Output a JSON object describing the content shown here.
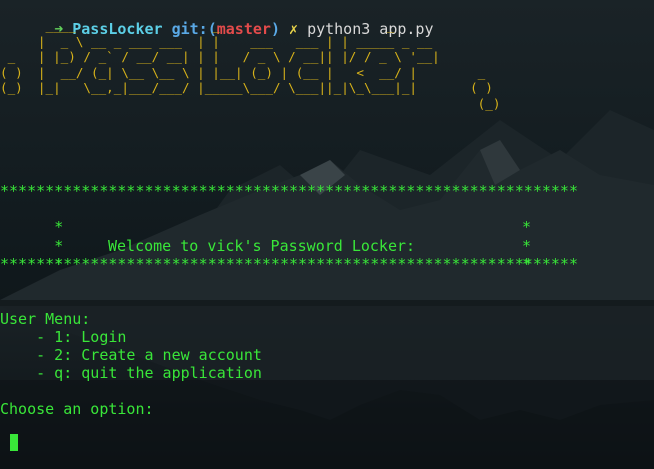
{
  "prompt": {
    "arrow": "➜",
    "directory": "PassLocker",
    "git_prefix": "git:(",
    "branch": "master",
    "git_suffix": ")",
    "dirty_marker": "✗",
    "command": "python3 app.py"
  },
  "ascii_art": {
    "lines": [
      "      ____                  _                      _",
      "     |  _ \\ __ _ ___ ___  | |    ___   ___ | | _____ _ __",
      " _   | |_) / _` / __/ __| | |   / _ \\ / __|| |/ / _ \\ '__|",
      "( )  |  __/ (_| \\__ \\__ \\ | |__| (_) | (__ |   <  __/ |        _",
      "(_)  |_|   \\__,_|___/___/ |_____\\___/ \\___||_|\\_\\___|_|       ( )",
      "                                                               (_)"
    ]
  },
  "banner": {
    "border": "****************************************************************",
    "blank_left": "*",
    "blank_right": "*",
    "welcome_text": "Welcome to vick's Password Locker:"
  },
  "menu": {
    "title": "User Menu:",
    "options": [
      "    - 1: Login",
      "    - 2: Create a new account",
      "    - q: quit the application"
    ],
    "choose_prompt": "Choose an option:"
  },
  "colors": {
    "output_green": "#39e639",
    "ascii_gold": "#d7b21a",
    "background": "#0b1114"
  }
}
